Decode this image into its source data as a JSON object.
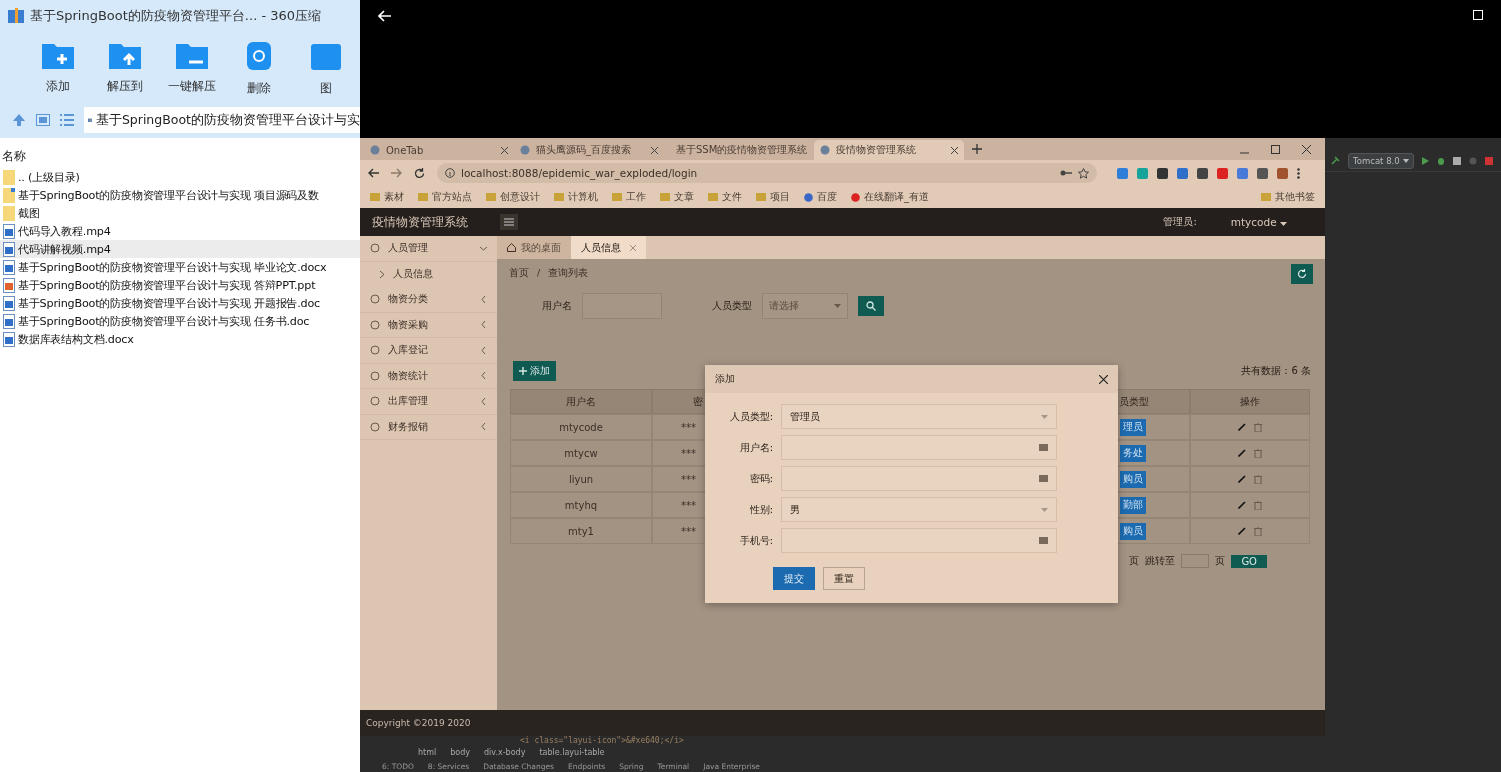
{
  "archiver": {
    "title": "基于SpringBoot的防疫物资管理平台... - 360压缩",
    "toolbar": [
      {
        "label": "添加",
        "kind": "add"
      },
      {
        "label": "解压到",
        "kind": "extract"
      },
      {
        "label": "一键解压",
        "kind": "oneclick"
      },
      {
        "label": "删除",
        "kind": "delete"
      },
      {
        "label": "图",
        "kind": "more"
      }
    ],
    "path": "基于SpringBoot的防疫物资管理平台设计与实",
    "column_header": "名称",
    "files": [
      {
        "name": ".. (上级目录)",
        "kind": "folder",
        "selected": false
      },
      {
        "name": "基于SpringBoot的防疫物资管理平台设计与实现 项目源码及数",
        "kind": "archive",
        "selected": false
      },
      {
        "name": "截图",
        "kind": "folder",
        "selected": false
      },
      {
        "name": "代码导入教程.mp4",
        "kind": "video",
        "selected": false
      },
      {
        "name": "代码讲解视频.mp4",
        "kind": "video",
        "selected": true
      },
      {
        "name": "基于SpringBoot的防疫物资管理平台设计与实现 毕业论文.docx",
        "kind": "word",
        "selected": false
      },
      {
        "name": "基于SpringBoot的防疫物资管理平台设计与实现 答辩PPT.ppt",
        "kind": "ppt",
        "selected": false
      },
      {
        "name": "基于SpringBoot的防疫物资管理平台设计与实现 开题报告.doc",
        "kind": "word",
        "selected": false
      },
      {
        "name": "基于SpringBoot的防疫物资管理平台设计与实现 任务书.doc",
        "kind": "word",
        "selected": false
      },
      {
        "name": "数据库表结构文档.docx",
        "kind": "word",
        "selected": false
      }
    ]
  },
  "browser": {
    "tabs": [
      {
        "label": "OneTab",
        "selected": false
      },
      {
        "label": "猫头鹰源码_百度搜索",
        "selected": false
      },
      {
        "label": "基于SSM的疫情物资管理系统",
        "selected": false
      },
      {
        "label": "疫情物资管理系统",
        "selected": true
      }
    ],
    "url": "localhost:8088/epidemic_war_exploded/login",
    "bookmarks": [
      {
        "label": "素材",
        "kind": "folder"
      },
      {
        "label": "官方站点",
        "kind": "folder"
      },
      {
        "label": "创意设计",
        "kind": "folder"
      },
      {
        "label": "计算机",
        "kind": "folder"
      },
      {
        "label": "工作",
        "kind": "folder"
      },
      {
        "label": "文章",
        "kind": "folder"
      },
      {
        "label": "文件",
        "kind": "folder"
      },
      {
        "label": "项目",
        "kind": "folder"
      },
      {
        "label": "百度",
        "kind": "site"
      },
      {
        "label": "在线翻译_有道",
        "kind": "site"
      }
    ],
    "other_bookmarks": "其他书签"
  },
  "app": {
    "title": "疫情物资管理系统",
    "user_label": "管理员:",
    "user": "mtycode",
    "sidebar": [
      {
        "label": "人员管理",
        "expanded": true,
        "children": [
          {
            "label": "人员信息"
          }
        ]
      },
      {
        "label": "物资分类",
        "expanded": false
      },
      {
        "label": "物资采购",
        "expanded": false
      },
      {
        "label": "入库登记",
        "expanded": false
      },
      {
        "label": "物资统计",
        "expanded": false
      },
      {
        "label": "出库管理",
        "expanded": false
      },
      {
        "label": "财务报销",
        "expanded": false
      }
    ],
    "tabs": [
      {
        "label": "我的桌面",
        "selected": false,
        "kind": "home"
      },
      {
        "label": "人员信息",
        "selected": true,
        "kind": "closable"
      }
    ],
    "breadcrumb": [
      "首页",
      "/",
      "查询列表"
    ],
    "search": [
      {
        "label": "用户名",
        "kind": "input"
      },
      {
        "label": "人员类型",
        "kind": "select",
        "placeholder": "请选择"
      }
    ],
    "add_button": "添加",
    "total": "共有数据：6 条",
    "table": {
      "columns": [
        "用户名",
        "密",
        "员类型",
        "操作"
      ],
      "rows": [
        {
          "username": "mtycode",
          "password": "***",
          "badge": "理员"
        },
        {
          "username": "mtycw",
          "password": "***",
          "badge": "务处"
        },
        {
          "username": "liyun",
          "password": "***",
          "badge": "购员"
        },
        {
          "username": "mtyhq",
          "password": "***",
          "badge": "勤部"
        },
        {
          "username": "mty1",
          "password": "***",
          "badge": "购员"
        }
      ]
    },
    "pagination": [
      "页",
      "跳转至",
      "页",
      "GO"
    ],
    "footer": "Copyright ©2019 2020"
  },
  "dialog": {
    "title": "添加",
    "fields": [
      {
        "label": "人员类型:",
        "kind": "select",
        "value": "管理员"
      },
      {
        "label": "用户名:",
        "kind": "input"
      },
      {
        "label": "密码:",
        "kind": "input"
      },
      {
        "label": "性别:",
        "kind": "select",
        "value": "男"
      },
      {
        "label": "手机号:",
        "kind": "input"
      }
    ],
    "buttons": [
      {
        "label": "提交",
        "primary": true
      },
      {
        "label": "重置",
        "primary": false
      }
    ]
  },
  "ide": {
    "run_config": "Tomcat 8.0",
    "code_line": "<i class=\"layui-icon\">&#xe640;</i>",
    "breadcrumb": [
      "html",
      "body",
      "div.x-body",
      "table.layui-table"
    ],
    "tool_windows": [
      "6: TODO",
      "8: Services",
      "Database Changes",
      "Endpoints",
      "Spring",
      "Terminal",
      "Java Enterprise"
    ]
  }
}
